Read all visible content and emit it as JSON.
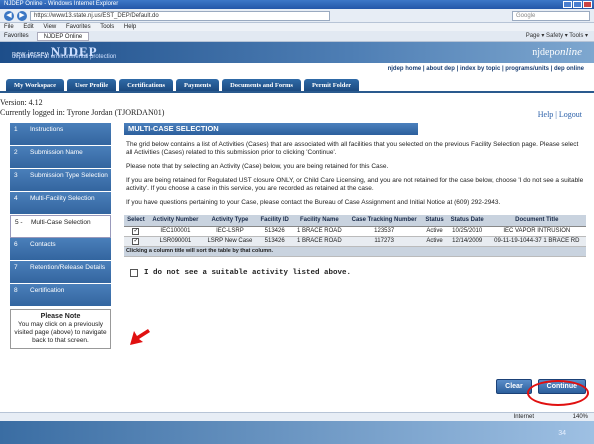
{
  "browser": {
    "window_title": "NJDEP Online - Windows Internet Explorer",
    "url": "https://www13.state.nj.us/EST_DEP/Default.do",
    "search_placeholder": "Google",
    "menu": [
      "File",
      "Edit",
      "View",
      "Favorites",
      "Tools",
      "Help"
    ],
    "favorites_label": "Favorites",
    "tab_title": "NJDEP Online",
    "tools_label": "Page ▾  Safety ▾  Tools ▾",
    "status_zone": "Internet",
    "zoom": "140%"
  },
  "site": {
    "banner_top": "new jersey",
    "banner_big": "NJDEP",
    "department": "department of environmental protection",
    "brand": "njdep",
    "brand_italic": "online",
    "top_links": "njdep home  |  about dep  |  index by topic  |  programs/units  |  dep online"
  },
  "tabs": [
    "My Workspace",
    "User Profile",
    "Certifications",
    "Payments",
    "Documents and Forms",
    "Permit Folder"
  ],
  "status": {
    "version": "Version: 4.12",
    "logged_in": "Currently logged in: Tyrone Jordan (TJORDAN01)",
    "help": "Help | Logout"
  },
  "sidebar": {
    "items": [
      {
        "num": "1",
        "label": "Instructions"
      },
      {
        "num": "2",
        "label": "Submission Name"
      },
      {
        "num": "3",
        "label": "Submission Type Selection"
      },
      {
        "num": "4",
        "label": "Multi-Facility Selection"
      },
      {
        "num": "5 -",
        "label": "Multi-Case Selection"
      },
      {
        "num": "6",
        "label": "Contacts"
      },
      {
        "num": "7",
        "label": "Retention/Release Details"
      },
      {
        "num": "8",
        "label": "Certification"
      }
    ],
    "note_title": "Please Note",
    "note_text": "You may click on a previously visited page (above) to navigate back to that screen."
  },
  "main": {
    "title": "MULTI-CASE SELECTION",
    "p1": "The grid below contains a list of Activities (Cases) that are associated with all facilities that you selected on the previous Facility Selection page. Please select all Activities (Cases) related to this submission prior to clicking 'Continue'.",
    "p2": "Please note that by selecting an Activity (Case) below, you are being retained for this Case.",
    "p3": "If you are being retained for Regulated UST closure ONLY, or Child Care Licensing, and you are not retained for the case below, choose 'I do not see a suitable activity'. If you choose a case in this service, you are recorded as retained at the case.",
    "p4": "If you have questions pertaining to your Case, please contact the Bureau of Case Assignment and Initial Notice at (609) 292-2943.",
    "columns": [
      "Select",
      "Activity Number",
      "Activity Type",
      "Facility ID",
      "Facility Name",
      "Case Tracking Number",
      "Status",
      "Status Date",
      "Document Title"
    ],
    "rows": [
      [
        "✓",
        "IEC100001",
        "IEC-LSRP",
        "513426",
        "1 BRACE ROAD",
        "123537",
        "Active",
        "10/25/2010",
        "IEC VAPOR INTRUSION"
      ],
      [
        "✓",
        "LSR090001",
        "LSRP New Case",
        "513426",
        "1 BRACE ROAD",
        "117273",
        "Active",
        "12/14/2009",
        "09-11-19-1044-37 1 BRACE RD"
      ]
    ],
    "table_note": "Clicking a column title will sort the table by that column.",
    "no_activity": "I do not see a suitable activity listed above.",
    "clear": "Clear",
    "continue": "Continue"
  },
  "page_number": "34"
}
